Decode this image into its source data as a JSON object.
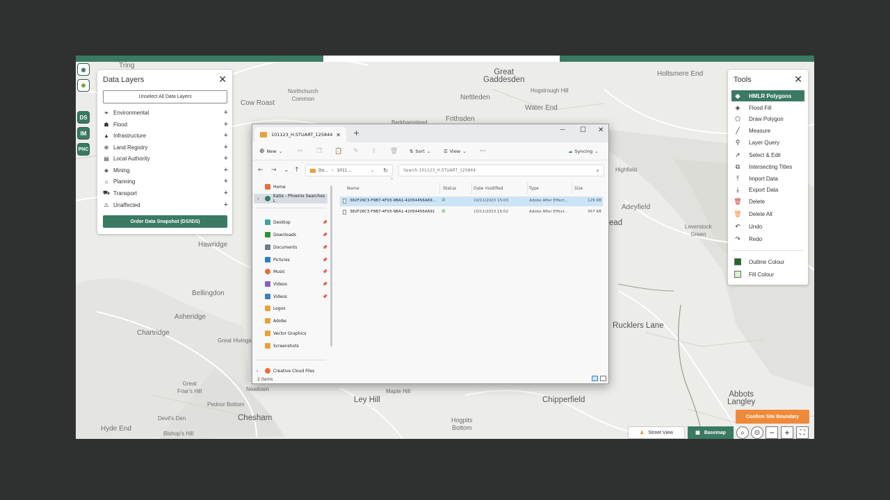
{
  "colors": {
    "brand": "#3a7a63",
    "accent": "#ef8a3a",
    "outline": "#1e6b2c",
    "fill": "#d9f2d2"
  },
  "map": {
    "labels": [
      {
        "text": "Tring",
        "cls": ""
      },
      {
        "text": "Great\nGaddesden",
        "cls": ""
      },
      {
        "text": "Holtsmere End",
        "cls": ""
      },
      {
        "text": "Northchurch\nCommon",
        "cls": ""
      },
      {
        "text": "Nettleden",
        "cls": ""
      },
      {
        "text": "Hogstrough Hill",
        "cls": ""
      },
      {
        "text": "Cow Roast",
        "cls": ""
      },
      {
        "text": "Water End",
        "cls": ""
      },
      {
        "text": "Berkhamstead",
        "cls": ""
      },
      {
        "text": "Frithsden",
        "cls": ""
      },
      {
        "text": "Highfield",
        "cls": ""
      },
      {
        "text": "Adeyfield",
        "cls": ""
      },
      {
        "text": "ead",
        "cls": "big"
      },
      {
        "text": "Leverstock\nGreen",
        "cls": ""
      },
      {
        "text": "Hawridge",
        "cls": ""
      },
      {
        "text": "Bellingdon",
        "cls": ""
      },
      {
        "text": "Asheridge",
        "cls": ""
      },
      {
        "text": "Chartridge",
        "cls": ""
      },
      {
        "text": "Great Hivings",
        "cls": ""
      },
      {
        "text": "Rucklers Lane",
        "cls": "big"
      },
      {
        "text": "Great\nFriar's Hill",
        "cls": ""
      },
      {
        "text": "Newtown",
        "cls": ""
      },
      {
        "text": "Maple Hill",
        "cls": ""
      },
      {
        "text": "Ley Hill",
        "cls": "big"
      },
      {
        "text": "Chipperfield",
        "cls": "big"
      },
      {
        "text": "Abbots\nLangley",
        "cls": "big"
      },
      {
        "text": "Pednor Bottom",
        "cls": ""
      },
      {
        "text": "Chesham",
        "cls": "big"
      },
      {
        "text": "Devil's Den",
        "cls": ""
      },
      {
        "text": "Hogpits\nBottom",
        "cls": ""
      },
      {
        "text": "Hyde End",
        "cls": ""
      },
      {
        "text": "Bishop's Hill",
        "cls": ""
      }
    ]
  },
  "sidebar": {
    "items": [
      "DS",
      "IM",
      "PNC"
    ]
  },
  "data_layers": {
    "title": "Data Layers",
    "close": "✕",
    "unselect_label": "Unselect All Data Layers",
    "items": [
      {
        "label": "Environmental",
        "icon": "leaf-icon"
      },
      {
        "label": "Flood",
        "icon": "flood-icon"
      },
      {
        "label": "Infrastructure",
        "icon": "road-icon"
      },
      {
        "label": "Land Registry",
        "icon": "globe-icon"
      },
      {
        "label": "Local Authority",
        "icon": "building-icon"
      },
      {
        "label": "Mining",
        "icon": "gem-icon"
      },
      {
        "label": "Planning",
        "icon": "house-icon"
      },
      {
        "label": "Transport",
        "icon": "car-icon"
      },
      {
        "label": "Unaffected",
        "icon": "warning-icon"
      }
    ],
    "plus": "+",
    "order_label": "Order Data Snapshot (DS/IDS)"
  },
  "tools": {
    "title": "Tools",
    "close": "✕",
    "items": [
      {
        "label": "HMLR Polygons",
        "glyph": "◆"
      },
      {
        "label": "Flood Fill",
        "glyph": "◈"
      },
      {
        "label": "Draw Polygon",
        "glyph": "⬠"
      },
      {
        "label": "Measure",
        "glyph": "╱"
      },
      {
        "label": "Layer Query",
        "glyph": "⚲"
      },
      {
        "label": "Select & Edit",
        "glyph": "➚"
      },
      {
        "label": "Intersecting Titles",
        "glyph": "⧉"
      },
      {
        "label": "Import Data",
        "glyph": "⤒"
      },
      {
        "label": "Export Data",
        "glyph": "⤓"
      },
      {
        "label": "Delete",
        "glyph": "🗑"
      },
      {
        "label": "Delete All",
        "glyph": "🗑"
      },
      {
        "label": "Undo",
        "glyph": "↶"
      },
      {
        "label": "Redo",
        "glyph": "↷"
      }
    ],
    "outline_label": "Outline Colour",
    "fill_label": "Fill Colour"
  },
  "map_controls": {
    "confirm_label": "Confirm Site Boundary",
    "street_view_label": "Street View",
    "basemap_label": "Basemap",
    "minus": "−",
    "plus": "+",
    "fullscreen": "⛶"
  },
  "explorer": {
    "tab_title": "101123_H.STUART_125844",
    "tab_close": "✕",
    "new_tab": "+",
    "window_controls": {
      "min": "—",
      "max": "☐",
      "close": "✕"
    },
    "toolbar": {
      "new": "New",
      "sort": "Sort",
      "view": "View",
      "more": "···",
      "syncing": "Syncing"
    },
    "address": {
      "part1": "Do...",
      "sep": "›",
      "part2": "1011..."
    },
    "search_placeholder": "Search 101123_H.STUART_125844",
    "nav": {
      "home": "Home",
      "cloud": "Katie - Phoenix Searches L",
      "quick": [
        {
          "label": "Desktop",
          "pinned": true,
          "color": "#3ba5a0"
        },
        {
          "label": "Downloads",
          "pinned": true,
          "color": "#2f8f3a"
        },
        {
          "label": "Documents",
          "pinned": true,
          "color": "#6e7a86"
        },
        {
          "label": "Pictures",
          "pinned": true,
          "color": "#2f7fbf"
        },
        {
          "label": "Music",
          "pinned": true,
          "color": "#e5703a"
        },
        {
          "label": "Videos",
          "pinned": true,
          "color": "#8b5fbf"
        },
        {
          "label": "Videos",
          "pinned": true,
          "color": "#3a7fbf"
        },
        {
          "label": "Logos",
          "pinned": false,
          "color": "#e9a23b"
        },
        {
          "label": "Adobe",
          "pinned": false,
          "color": "#e9a23b"
        },
        {
          "label": "Vector Graphics",
          "pinned": false,
          "color": "#e9a23b"
        },
        {
          "label": "Screenshots",
          "pinned": false,
          "color": "#e9a23b"
        }
      ],
      "creative": "Creative Cloud Files",
      "pin": "📌"
    },
    "columns": {
      "name": "Name",
      "status": "Status",
      "date": "Date modified",
      "type": "Type",
      "size": "Size"
    },
    "files": [
      {
        "name": "382F26C3-F9B7-4F03-9BA1-42054456A69...",
        "date": "10/11/2023 15:03",
        "type": "Adobe After Effect...",
        "size": "129 KB"
      },
      {
        "name": "382F26C3-F9B7-4F03-9BA1-42054456A691",
        "date": "10/11/2023 15:02",
        "type": "Adobe After Effect...",
        "size": "367 KB"
      }
    ],
    "status_text": "2 items"
  }
}
